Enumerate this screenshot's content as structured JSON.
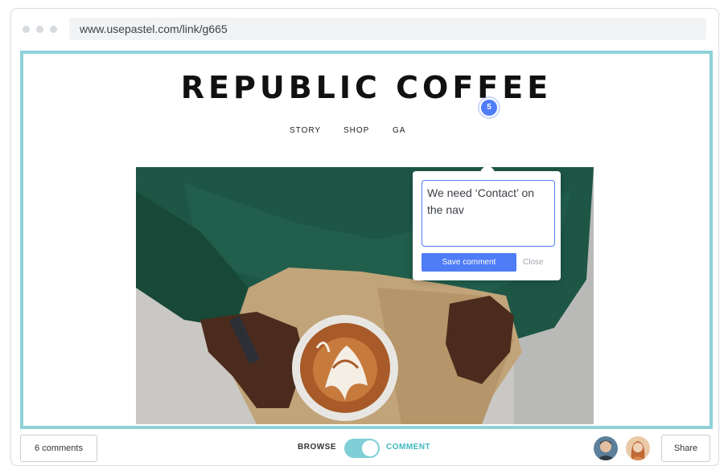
{
  "browser": {
    "url": "www.usepastel.com/link/g665"
  },
  "site": {
    "title": "REPUBLIC COFFEE",
    "nav": [
      "STORY",
      "SHOP",
      "GA"
    ]
  },
  "hero": {
    "icon": "coffee-cup-photo"
  },
  "comment_popover": {
    "pin_number": "5",
    "text": "We need ‘Contact’ on the nav",
    "save_label": "Save comment",
    "close_label": "Close"
  },
  "bottom_bar": {
    "comments_count_label": "6 comments",
    "browse_label": "BROWSE",
    "comment_label": "COMMENT",
    "share_label": "Share",
    "mode": "comment"
  },
  "colors": {
    "accent": "#4f7cf7",
    "viewport_border": "#8ed2d8",
    "toggle": "#7fcfd6",
    "comment_mode": "#3fb6c0"
  }
}
